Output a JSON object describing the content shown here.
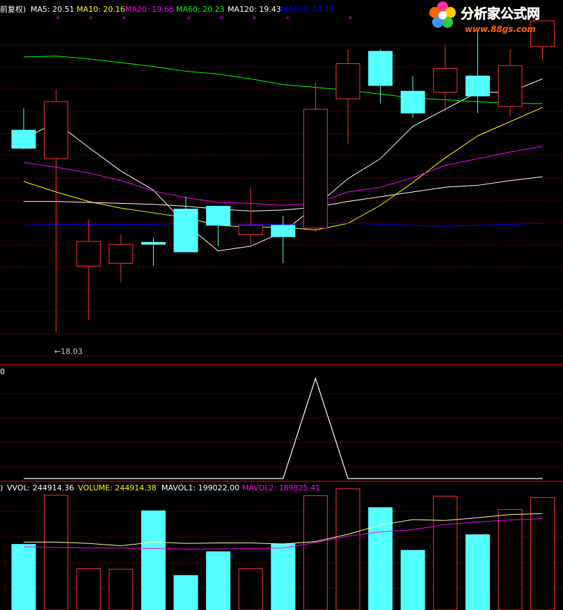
{
  "chart_data": [
    {
      "type": "candlestick",
      "header": {
        "adj": "前复权)",
        "ma": [
          {
            "label": "MA5: 20.51",
            "color": "#ffffff"
          },
          {
            "label": "MA10: 20.16",
            "color": "#ffff00"
          },
          {
            "label": "MA20: 19.66",
            "color": "#ff00ff"
          },
          {
            "label": "MA60: 20.23",
            "color": "#00ff00"
          },
          {
            "label": "MA120: 19.43",
            "color": "#ffffff"
          },
          {
            "label": "MA250: 19.17",
            "color": "#0000ff"
          }
        ]
      },
      "ylim": [
        17.7,
        21.3
      ],
      "low_annotation": "18.03",
      "candles": [
        {
          "o": 20.15,
          "h": 20.38,
          "l": 19.95,
          "c": 19.96
        },
        {
          "o": 19.85,
          "h": 20.58,
          "l": 18.03,
          "c": 20.45
        },
        {
          "o": 18.72,
          "h": 19.21,
          "l": 18.15,
          "c": 18.98
        },
        {
          "o": 18.75,
          "h": 19.05,
          "l": 18.55,
          "c": 18.95
        },
        {
          "o": 18.97,
          "h": 19.02,
          "l": 18.72,
          "c": 18.95
        },
        {
          "o": 19.32,
          "h": 19.45,
          "l": 18.88,
          "c": 18.87
        },
        {
          "o": 19.35,
          "h": 19.29,
          "l": 18.93,
          "c": 19.15
        },
        {
          "o": 19.05,
          "h": 19.55,
          "l": 18.95,
          "c": 19.15
        },
        {
          "o": 19.15,
          "h": 19.25,
          "l": 18.75,
          "c": 19.03
        },
        {
          "o": 19.12,
          "h": 20.65,
          "l": 19.08,
          "c": 20.37
        },
        {
          "o": 20.48,
          "h": 21.0,
          "l": 20.0,
          "c": 20.85
        },
        {
          "o": 20.98,
          "h": 21.0,
          "l": 20.43,
          "c": 20.62
        },
        {
          "o": 20.56,
          "h": 20.72,
          "l": 20.28,
          "c": 20.33
        },
        {
          "o": 20.55,
          "h": 21.05,
          "l": 20.35,
          "c": 20.8
        },
        {
          "o": 20.72,
          "h": 21.2,
          "l": 20.33,
          "c": 20.51
        },
        {
          "o": 20.4,
          "h": 21.0,
          "l": 20.3,
          "c": 20.83
        },
        {
          "o": 21.03,
          "h": 21.24,
          "l": 20.88,
          "c": 21.3
        }
      ],
      "ma_lines": {
        "MA5": [
          20.06,
          20.23,
          19.97,
          19.72,
          19.52,
          19.16,
          18.88,
          18.93,
          19.08,
          19.35,
          19.64,
          19.85,
          20.19,
          20.37,
          20.55,
          20.55,
          20.69
        ],
        "MA10": [
          19.61,
          19.5,
          19.4,
          19.33,
          19.28,
          19.23,
          19.15,
          19.13,
          19.13,
          19.1,
          19.17,
          19.36,
          19.6,
          19.86,
          20.09,
          20.24,
          20.39
        ],
        "MA20": [
          19.81,
          19.76,
          19.7,
          19.62,
          19.51,
          19.44,
          19.39,
          19.38,
          19.36,
          19.38,
          19.5,
          19.55,
          19.65,
          19.78,
          19.85,
          19.92,
          19.98
        ],
        "MA60": [
          20.92,
          20.93,
          20.9,
          20.86,
          20.82,
          20.77,
          20.74,
          20.69,
          20.63,
          20.6,
          20.57,
          20.53,
          20.49,
          20.47,
          20.45,
          20.43,
          20.43
        ],
        "MA120": [
          19.4,
          19.4,
          19.39,
          19.38,
          19.37,
          19.35,
          19.32,
          19.3,
          19.31,
          19.34,
          19.4,
          19.45,
          19.5,
          19.55,
          19.57,
          19.62,
          19.66
        ],
        "MA250": [
          19.15,
          19.16,
          19.16,
          19.16,
          19.16,
          19.17,
          19.17,
          19.16,
          19.16,
          19.17,
          19.17,
          19.16,
          19.15,
          19.14,
          19.15,
          19.16,
          19.17
        ]
      }
    },
    {
      "type": "line",
      "label": "0",
      "ylim": [
        0,
        1
      ],
      "x": [
        0,
        1,
        2,
        3,
        4,
        5,
        6,
        7,
        8,
        9,
        10,
        11,
        12,
        13,
        14,
        15,
        16
      ],
      "values": [
        0,
        0,
        0,
        0,
        0,
        0,
        0,
        0,
        0,
        1,
        0,
        0,
        0,
        0,
        0,
        0,
        0
      ]
    },
    {
      "type": "bar",
      "header": [
        {
          "label": ")",
          "color": "#ffffff"
        },
        {
          "label": "VVOL: 244914.36",
          "color": "#ffffff"
        },
        {
          "label": "VOLUME: 244914.38",
          "color": "#ffff00"
        },
        {
          "label": "MAVOL1: 199022.00",
          "color": "#ffffff"
        },
        {
          "label": "MAVOL2: 189825.41",
          "color": "#ff00ff"
        }
      ],
      "ylim": [
        0,
        250000
      ],
      "values": [
        143000,
        250000,
        90000,
        89000,
        216000,
        75000,
        127000,
        90000,
        144000,
        249000,
        264000,
        223000,
        130000,
        248000,
        164000,
        219000,
        245000
      ],
      "mavol1": [
        148000,
        148000,
        145000,
        140000,
        148000,
        145000,
        146000,
        146000,
        144000,
        149000,
        165000,
        185000,
        197000,
        195000,
        201000,
        208000,
        210000
      ],
      "mavol2": [
        138000,
        136000,
        135000,
        135000,
        134000,
        133000,
        133000,
        134000,
        135000,
        147000,
        161000,
        170000,
        175000,
        186000,
        192000,
        196000,
        199000
      ]
    }
  ],
  "watermark": {
    "title": "分析家公式网",
    "url": "www.88gs.com"
  }
}
